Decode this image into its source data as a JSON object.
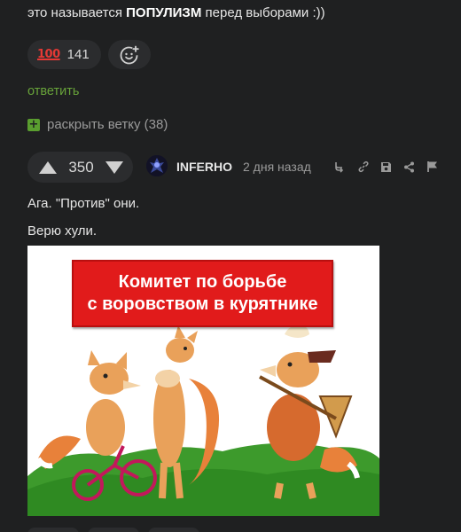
{
  "parent_comment": {
    "text_before": "это называется ",
    "text_bold": "ПОПУЛИЗМ",
    "text_after": " перед выборами :))",
    "reaction": {
      "emoji": "💯",
      "emoji_label": "100",
      "count": "141"
    },
    "add_reaction_icon": "smile-plus-icon",
    "reply_label": "ответить",
    "expand_thread_label": "раскрыть ветку (38)"
  },
  "comment": {
    "score": "350",
    "author": "INFERHO",
    "time": "2 дня назад",
    "tools": [
      "branch-icon",
      "link-icon",
      "save-icon",
      "share-icon",
      "report-flag-icon"
    ],
    "lines": [
      "Ага. \"Против\" они.",
      "Верю хули."
    ],
    "image": {
      "banner_line1": "Комитет по борьбе",
      "banner_line2": "с воровством в курятнике"
    }
  },
  "colors": {
    "background": "#1f2021",
    "pill": "#2b2c2e",
    "green": "#68a33a",
    "muted": "#9a9a9a",
    "banner_red": "#e11b1b"
  }
}
